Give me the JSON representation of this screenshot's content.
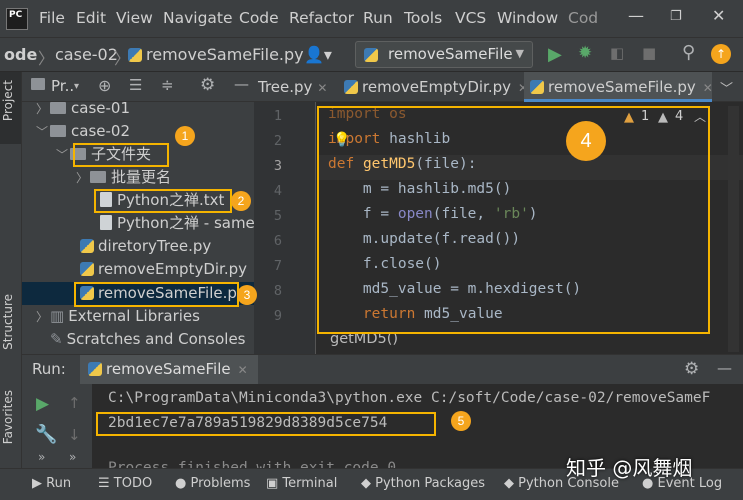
{
  "app": {
    "logo": "PC"
  },
  "menu": [
    "File",
    "Edit",
    "View",
    "Navigate",
    "Code",
    "Refactor",
    "Run",
    "Tools",
    "VCS",
    "Window",
    "Cod"
  ],
  "navbar": {
    "crumbs": [
      "ode",
      "case-02",
      "removeSameFile.py"
    ],
    "run_config": "removeSameFile"
  },
  "project_panel": {
    "title": "Pr..",
    "items": [
      {
        "label": "case-01"
      },
      {
        "label": "case-02"
      },
      {
        "label": "子文件夹"
      },
      {
        "label": "批量更名"
      },
      {
        "label": "Python之禅.txt"
      },
      {
        "label": "Python之禅 - same"
      },
      {
        "label": "diretoryTree.py"
      },
      {
        "label": "removeEmptyDir.py"
      },
      {
        "label": "removeSameFile.py"
      },
      {
        "label": "External Libraries"
      },
      {
        "label": "Scratches and Consoles"
      }
    ]
  },
  "side_tabs": {
    "project": "Project",
    "structure": "Structure",
    "favorites": "Favorites"
  },
  "editor": {
    "tabs": [
      "Tree.py",
      "removeEmptyDir.py",
      "removeSameFile.py"
    ],
    "warnings": {
      "a": "1",
      "b": "4"
    },
    "line_numbers": [
      "1",
      "2",
      "3",
      "4",
      "5",
      "6",
      "7",
      "8",
      "9"
    ],
    "lines": [
      [
        "import os"
      ],
      [
        "import hashlib"
      ],
      [
        "def getMD5(file):"
      ],
      [
        "    m = hashlib.md5()"
      ],
      [
        "    f = open(file, 'rb')"
      ],
      [
        "    m.update(f.read())"
      ],
      [
        "    f.close()"
      ],
      [
        "    md5_value = m.hexdigest()"
      ],
      [
        "    return md5_value"
      ]
    ],
    "breadcrumb": "getMD5()"
  },
  "run": {
    "label": "Run:",
    "config": "removeSameFile",
    "command": "C:\\ProgramData\\Miniconda3\\python.exe C:/soft/Code/case-02/removeSameF",
    "output": "2bd1ec7e7a789a519829d8389d5ce754",
    "finished": "Process finished with exit code 0"
  },
  "bottom_tabs": [
    "Run",
    "TODO",
    "Problems",
    "Terminal",
    "Python Packages",
    "Python Console",
    "Event Log"
  ],
  "annotations": [
    "1",
    "2",
    "3",
    "4",
    "5"
  ],
  "watermark": "知乎 @风舞烟",
  "colors": {
    "highlight": "#f5b400",
    "badge": "#f5a51d"
  }
}
